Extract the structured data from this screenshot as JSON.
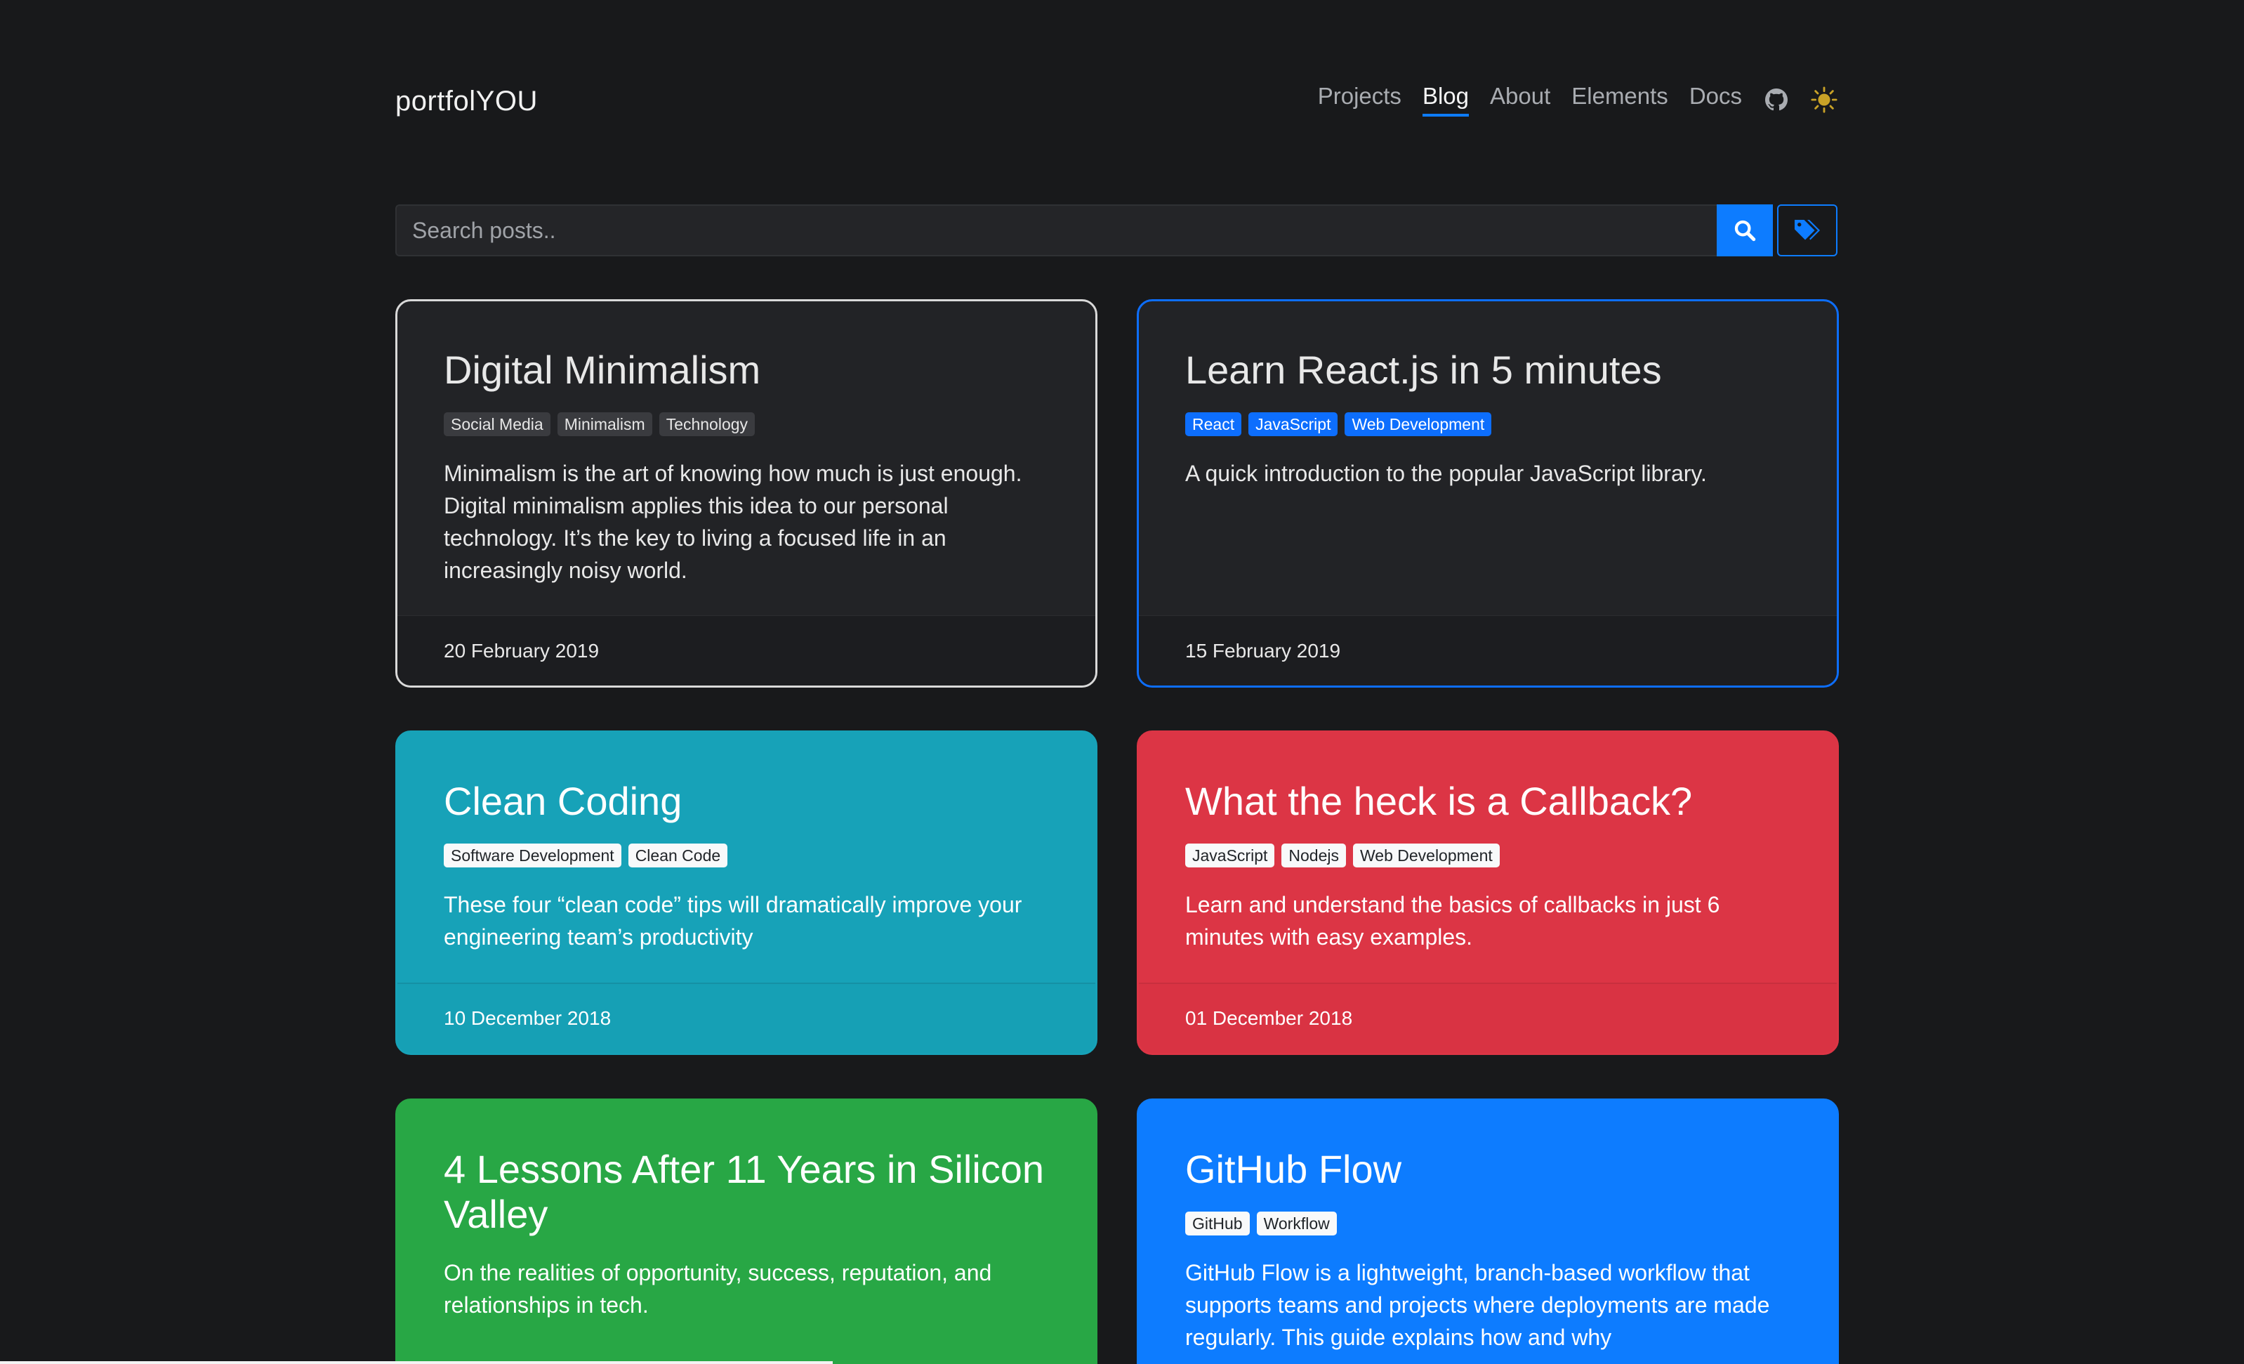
{
  "header": {
    "brand": "portfolYOU",
    "nav": [
      {
        "label": "Projects",
        "active": false
      },
      {
        "label": "Blog",
        "active": true
      },
      {
        "label": "About",
        "active": false
      },
      {
        "label": "Elements",
        "active": false
      },
      {
        "label": "Docs",
        "active": false
      }
    ],
    "icons": [
      "github-icon",
      "sun-icon"
    ]
  },
  "search": {
    "placeholder": "Search posts..",
    "value": ""
  },
  "posts": [
    {
      "title": "Digital Minimalism",
      "tags": [
        "Social Media",
        "Minimalism",
        "Technology"
      ],
      "excerpt": "Minimalism is the art of knowing how much is just enough. Digital minimalism applies this idea to our personal technology. It’s the key to living a focused life in an increasingly noisy world.",
      "date": "20 February 2019",
      "style": "dark"
    },
    {
      "title": "Learn React.js in 5 minutes",
      "tags": [
        "React",
        "JavaScript",
        "Web Development"
      ],
      "excerpt": "A quick introduction to the popular JavaScript library.",
      "date": "15 February 2019",
      "style": "primary-outline"
    },
    {
      "title": "Clean Coding",
      "tags": [
        "Software Development",
        "Clean Code"
      ],
      "excerpt": "These four “clean code” tips will dramatically improve your engineering team’s productivity",
      "date": "10 December 2018",
      "style": "info"
    },
    {
      "title": "What the heck is a Callback?",
      "tags": [
        "JavaScript",
        "Nodejs",
        "Web Development"
      ],
      "excerpt": "Learn and understand the basics of callbacks in just 6 minutes with easy examples.",
      "date": "01 December 2018",
      "style": "danger"
    },
    {
      "title": "4 Lessons After 11 Years in Silicon Valley",
      "tags": [],
      "excerpt": "On the realities of opportunity, success, reputation, and relationships in tech.",
      "date": "",
      "style": "success"
    },
    {
      "title": "GitHub Flow",
      "tags": [
        "GitHub",
        "Workflow"
      ],
      "excerpt": "GitHub Flow is a lightweight, branch-based workflow that supports teams and projects where deployments are made regularly. This guide explains how and why",
      "date": "",
      "style": "primary"
    }
  ],
  "colors": {
    "background": "#18191b",
    "accent": "#0d7cff",
    "info": "#17a2b8",
    "danger": "#dc3545",
    "success": "#28a745",
    "sun": "#c9a227"
  }
}
